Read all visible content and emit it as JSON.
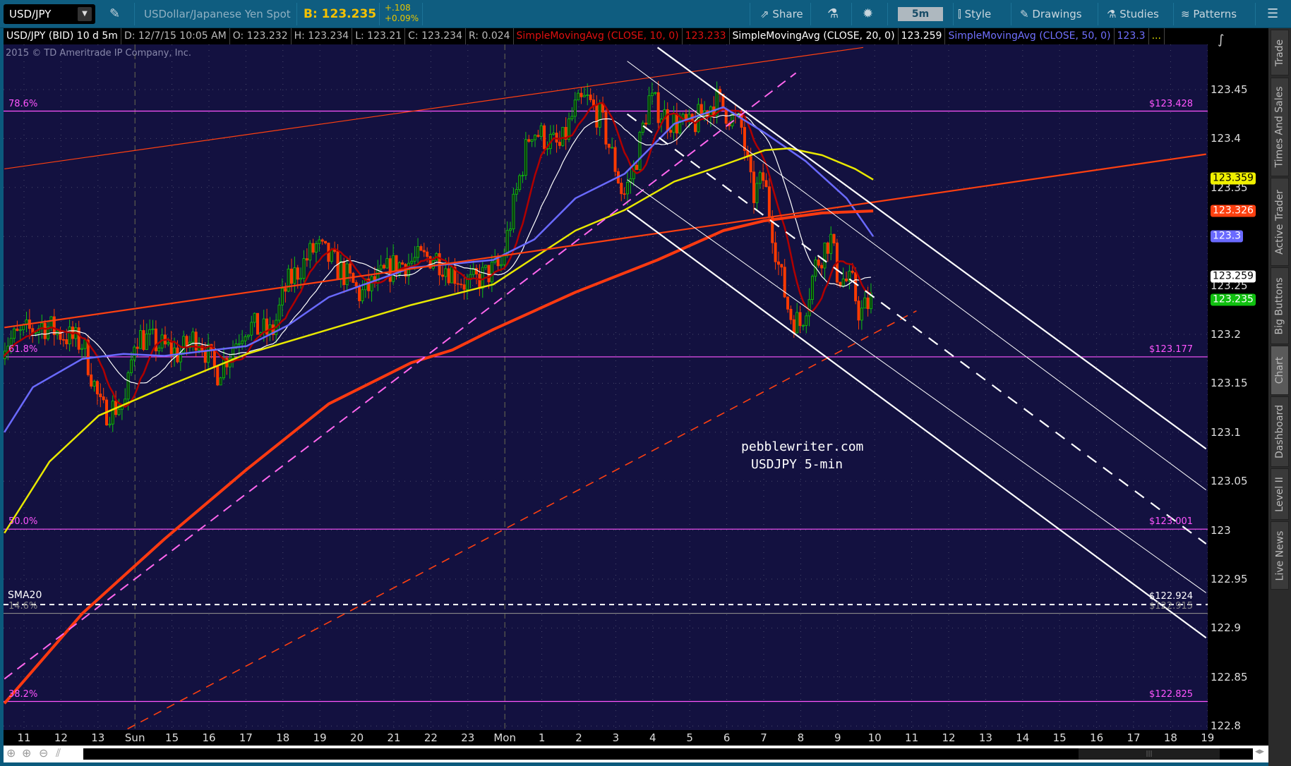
{
  "toolbar": {
    "symbol": "USD/JPY",
    "description": "USDollar/Japanese Yen Spot",
    "bid": "B: 123.235",
    "change": "+.108",
    "change_pct": "+0.09%",
    "share": "Share",
    "timeframe": "5m",
    "style": "Style",
    "drawings": "Drawings",
    "studies": "Studies",
    "patterns": "Patterns"
  },
  "info": {
    "symbol": "USD/JPY (BID) 10 d 5m",
    "date": "D: 12/7/15 10:05 AM",
    "open": "O: 123.232",
    "high": "H: 123.234",
    "low": "L: 123.21",
    "close": "C: 123.234",
    "range": "R: 0.024",
    "sma10_label": "SimpleMovingAvg (CLOSE, 10, 0)",
    "sma10_value": "123.233",
    "sma20_label": "SimpleMovingAvg (CLOSE, 20, 0)",
    "sma20_value": "123.259",
    "sma50_label": "SimpleMovingAvg (CLOSE, 50, 0)",
    "sma50_value": "123.3",
    "more": "..."
  },
  "copyright": "2015 © TD Ameritrade IP Company, Inc.",
  "watermark": {
    "line1": "pebblewriter.com",
    "line2": "USDJPY 5-min"
  },
  "sidebar": [
    "Trade",
    "Times And Sales",
    "Active Trader",
    "Big Buttons",
    "Chart",
    "Dashboard",
    "Level II",
    "Live News"
  ],
  "badges": [
    {
      "text": "123.359",
      "price": 123.359,
      "bg": "#f0f000",
      "fg": "#000"
    },
    {
      "text": "123.326",
      "price": 123.326,
      "bg": "#ff4010",
      "fg": "#fff"
    },
    {
      "text": "123.3",
      "price": 123.3,
      "bg": "#6a6aff",
      "fg": "#fff"
    },
    {
      "text": "123.259",
      "price": 123.259,
      "bg": "#ffffff",
      "fg": "#000"
    },
    {
      "text": "123.235",
      "price": 123.235,
      "bg": "#10c010",
      "fg": "#fff"
    }
  ],
  "chart_data": {
    "type": "candlestick",
    "title": "USD/JPY (BID) 10 d 5m",
    "ylim": [
      122.8,
      123.48
    ],
    "yticks": [
      "123.45",
      "123.4",
      "123.35",
      "123.3",
      "123.25",
      "123.2",
      "123.15",
      "123.1",
      "123.05",
      "123",
      "122.95",
      "122.9",
      "122.85",
      "122.8"
    ],
    "xticks": [
      "11",
      "12",
      "13",
      "Sun",
      "15",
      "16",
      "17",
      "18",
      "19",
      "20",
      "21",
      "22",
      "23",
      "Mon",
      "1",
      "2",
      "3",
      "4",
      "5",
      "6",
      "7",
      "8",
      "9",
      "10",
      "11",
      "12",
      "13",
      "14",
      "15",
      "16",
      "17",
      "18",
      "19"
    ],
    "price_path": [
      [
        -0.6,
        123.19
      ],
      [
        0.5,
        123.21
      ],
      [
        1.6,
        123.19
      ],
      [
        2.1,
        123.12
      ],
      [
        2.75,
        123.13
      ],
      [
        3.0,
        123.2
      ],
      [
        4.2,
        123.18
      ],
      [
        4.7,
        123.2
      ],
      [
        5.2,
        123.16
      ],
      [
        6.0,
        123.21
      ],
      [
        6.7,
        123.2
      ],
      [
        7.1,
        123.25
      ],
      [
        7.9,
        123.29
      ],
      [
        8.7,
        123.26
      ],
      [
        9.1,
        123.24
      ],
      [
        10.0,
        123.27
      ],
      [
        11.1,
        123.28
      ],
      [
        12.0,
        123.25
      ],
      [
        12.9,
        123.27
      ],
      [
        13.4,
        123.36
      ],
      [
        13.7,
        123.41
      ],
      [
        14.5,
        123.39
      ],
      [
        14.9,
        123.43
      ],
      [
        15.2,
        123.44
      ],
      [
        15.6,
        123.42
      ],
      [
        16.0,
        123.37
      ],
      [
        16.2,
        123.34
      ],
      [
        16.5,
        123.37
      ],
      [
        16.9,
        123.44
      ],
      [
        17.4,
        123.42
      ],
      [
        18.0,
        123.41
      ],
      [
        18.7,
        123.44
      ],
      [
        19.4,
        123.41
      ],
      [
        19.7,
        123.34
      ],
      [
        20.0,
        123.36
      ],
      [
        20.4,
        123.27
      ],
      [
        20.7,
        123.22
      ],
      [
        21.0,
        123.21
      ],
      [
        21.4,
        123.27
      ],
      [
        21.8,
        123.3
      ],
      [
        22.0,
        123.26
      ],
      [
        22.4,
        123.25
      ],
      [
        22.6,
        123.22
      ],
      [
        22.9,
        123.235
      ]
    ],
    "studies": [
      {
        "name": "SMA50",
        "color": "#6a6aff",
        "points": [
          [
            -0.53,
            123.1
          ],
          [
            0.24,
            123.146
          ],
          [
            1.58,
            123.175
          ],
          [
            2.69,
            123.18
          ],
          [
            3.8,
            123.178
          ],
          [
            6.02,
            123.188
          ],
          [
            7.13,
            123.209
          ],
          [
            8.24,
            123.238
          ],
          [
            10.47,
            123.268
          ],
          [
            12.69,
            123.276
          ],
          [
            13.8,
            123.297
          ],
          [
            14.91,
            123.339
          ],
          [
            16.24,
            123.364
          ],
          [
            17.58,
            123.415
          ],
          [
            18.91,
            123.432
          ],
          [
            20.02,
            123.406
          ],
          [
            21.13,
            123.377
          ],
          [
            22.24,
            123.339
          ],
          [
            22.96,
            123.3
          ]
        ]
      },
      {
        "name": "Yellow MA",
        "color": "#e8e800",
        "points": [
          [
            -0.53,
            122.997
          ],
          [
            0.69,
            123.07
          ],
          [
            2.02,
            123.117
          ],
          [
            3.8,
            123.146
          ],
          [
            6.02,
            123.18
          ],
          [
            8.24,
            123.205
          ],
          [
            10.47,
            123.23
          ],
          [
            12.69,
            123.251
          ],
          [
            14.91,
            123.306
          ],
          [
            16.24,
            123.327
          ],
          [
            17.58,
            123.356
          ],
          [
            18.91,
            123.373
          ],
          [
            20.02,
            123.388
          ],
          [
            20.69,
            123.39
          ],
          [
            21.58,
            123.383
          ],
          [
            22.47,
            123.369
          ],
          [
            22.96,
            123.358
          ]
        ]
      },
      {
        "name": "Orange MA",
        "color": "#ff3a10",
        "points": [
          [
            -0.53,
            122.823
          ],
          [
            1.58,
            122.915
          ],
          [
            3.8,
            122.991
          ],
          [
            6.02,
            123.062
          ],
          [
            8.24,
            123.129
          ],
          [
            10.47,
            123.171
          ],
          [
            11.58,
            123.184
          ],
          [
            12.69,
            123.205
          ],
          [
            14.91,
            123.243
          ],
          [
            17.13,
            123.276
          ],
          [
            18.91,
            123.306
          ],
          [
            20.02,
            123.316
          ],
          [
            21.58,
            123.324
          ],
          [
            22.96,
            123.326
          ]
        ]
      }
    ],
    "trendlines": [
      {
        "color": "#ff4010",
        "width": 1.2,
        "dash": "",
        "p1": [
          -0.53,
          123.369
        ],
        "p2": [
          22.69,
          123.493
        ]
      },
      {
        "color": "#ff4010",
        "width": 2.2,
        "dash": "",
        "p1": [
          -0.53,
          123.207
        ],
        "p2": [
          31.96,
          123.384
        ]
      },
      {
        "color": "#ff66ee",
        "width": 2,
        "dash": "14,9",
        "p1": [
          -0.53,
          122.848
        ],
        "p2": [
          20.87,
          123.467
        ]
      },
      {
        "color": "#ff4010",
        "width": 1.6,
        "dash": "12,9",
        "p1": [
          2.8,
          122.797
        ],
        "p2": [
          24.13,
          123.224
        ]
      },
      {
        "color": "#ffffff",
        "width": 2.2,
        "dash": "",
        "p1": [
          17.13,
          123.493
        ],
        "p2": [
          31.96,
          123.083
        ]
      },
      {
        "color": "#ffffff",
        "width": 1,
        "dash": "",
        "p1": [
          16.31,
          123.479
        ],
        "p2": [
          31.96,
          123.041
        ]
      },
      {
        "color": "#ffffff",
        "width": 2.2,
        "dash": "16,12",
        "p1": [
          16.31,
          123.425
        ],
        "p2": [
          31.96,
          122.986
        ]
      },
      {
        "color": "#ffffff",
        "width": 1,
        "dash": "",
        "p1": [
          16.31,
          123.358
        ],
        "p2": [
          31.96,
          122.936
        ]
      },
      {
        "color": "#ffffff",
        "width": 2.2,
        "dash": "",
        "p1": [
          16.31,
          123.327
        ],
        "p2": [
          31.96,
          122.89
        ]
      }
    ],
    "fib_levels": [
      {
        "pct": "78.6%",
        "price": 123.428,
        "label": "$123.428",
        "color": "#ff55ff"
      },
      {
        "pct": "61.8%",
        "price": 123.177,
        "label": "$123.177",
        "color": "#ff55ff"
      },
      {
        "pct": "50.0%",
        "price": 123.001,
        "label": "$123.001",
        "color": "#ff55ff"
      },
      {
        "pct": "14.6%",
        "price": 122.915,
        "label": "$122.915",
        "color": "#888888"
      },
      {
        "pct": "38.2%",
        "price": 122.825,
        "label": "$122.825",
        "color": "#ff55ff"
      }
    ],
    "sma20_line": {
      "label": "SMA20",
      "price": 122.924,
      "value": "$122.924"
    }
  }
}
